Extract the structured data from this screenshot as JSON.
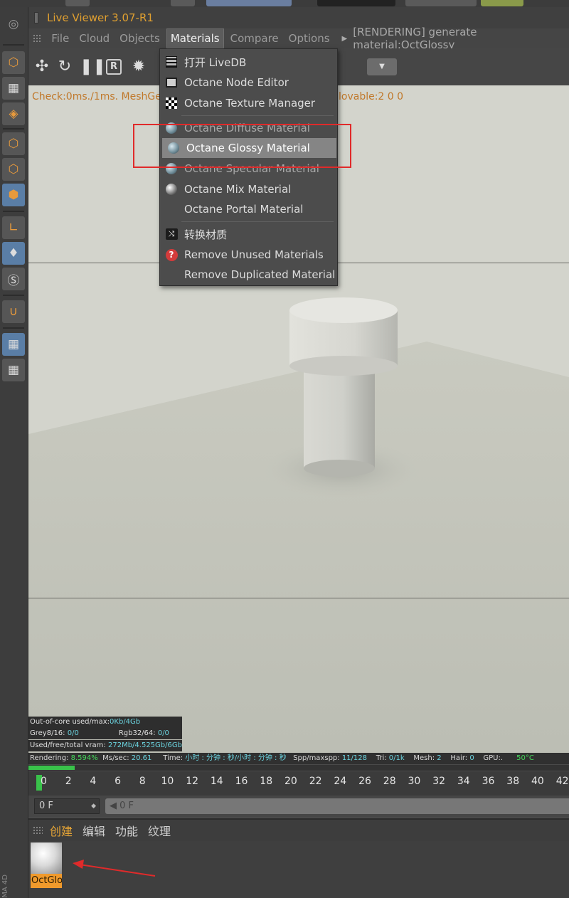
{
  "window": {
    "title": "Live Viewer 3.07-R1"
  },
  "menubar": {
    "items": [
      "File",
      "Cloud",
      "Objects",
      "Materials",
      "Compare",
      "Options"
    ],
    "active": "Materials",
    "status": "[RENDERING] generate material:OctGlossy"
  },
  "toolbar": {
    "icons": [
      "octane-logo-icon",
      "refresh-icon",
      "pause-icon",
      "r-icon",
      "settings-icon"
    ],
    "r_label": "R"
  },
  "viewport": {
    "check_text": "Check:0ms./1ms. MeshGe",
    "check_text_right": "lovable:2  0 0"
  },
  "materials_menu": {
    "items": [
      {
        "label": "打开 LiveDB",
        "icon": "grid-icon"
      },
      {
        "label": "Octane Node Editor",
        "icon": "node-editor-icon"
      },
      {
        "label": "Octane Texture Manager",
        "icon": "checker-icon"
      },
      {
        "label": "Octane Diffuse Material",
        "icon": "sphere-icon"
      },
      {
        "label": "Octane Glossy Material",
        "icon": "sphere-icon"
      },
      {
        "label": "Octane Specular Material",
        "icon": "sphere-icon"
      },
      {
        "label": "Octane Mix Material",
        "icon": "mix-sphere-icon"
      },
      {
        "label": "Octane Portal Material",
        "icon": ""
      },
      {
        "label": "转换材质",
        "icon": "shuffle-icon"
      },
      {
        "label": "Remove Unused Materials",
        "icon": "question-icon"
      },
      {
        "label": "Remove Duplicated Material",
        "icon": ""
      }
    ],
    "selected": "Octane Glossy Material"
  },
  "render_info": {
    "outofcore_label": "Out-of-core used/max:",
    "outofcore_value": "0Kb/4Gb",
    "grey_label": "Grey8/16: ",
    "grey_value": "0/0",
    "rgb_label": "Rgb32/64: ",
    "rgb_value": "0/0",
    "vram_label": "Used/free/total vram: ",
    "vram_value": "272Mb/4.525Gb/6Gb",
    "rendering_label": "Rendering: ",
    "rendering_value": "8.594%",
    "mssec_label": "Ms/sec: ",
    "mssec_value": "20.61",
    "time_label": "Time: ",
    "time_value": "小时 : 分钟 : 秒/小时 : 分钟 : 秒",
    "spp_label": "Spp/maxspp: ",
    "spp_value": "11/128",
    "tri_label": "Tri: ",
    "tri_value": "0/1k",
    "mesh_label": "Mesh: ",
    "mesh_value": "2",
    "hair_label": "Hair: ",
    "hair_value": "0",
    "gpu_label": "GPU:.",
    "gpu_value": "50°C",
    "progress": 0.0859
  },
  "timeline": {
    "ticks": [
      "0",
      "2",
      "4",
      "6",
      "8",
      "10",
      "12",
      "14",
      "16",
      "18",
      "20",
      "22",
      "24",
      "26",
      "28",
      "30",
      "32",
      "34",
      "36",
      "38",
      "40",
      "42"
    ],
    "current_frame": "0 F",
    "slider_frame": "0 F"
  },
  "material_manager": {
    "menu": [
      "创建",
      "编辑",
      "功能",
      "纹理"
    ],
    "highlighted": "创建",
    "material_name": "OctGlossy"
  },
  "brand": "MA 4D",
  "colors": {
    "accent": "#e0a030",
    "highlight_box": "#e02a2a",
    "progress": "#39c24a",
    "info_value": "#6bd4e0"
  }
}
